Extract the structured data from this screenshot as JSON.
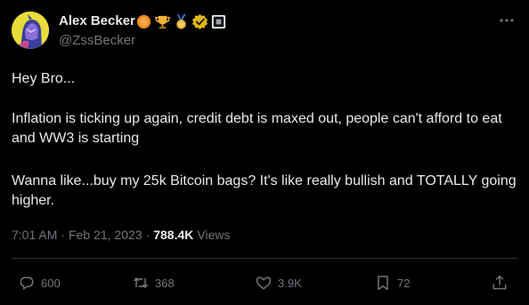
{
  "author": {
    "name": "Alex Becker",
    "handle": "@ZssBecker",
    "badges": [
      "orange-circle-icon",
      "trophy-icon",
      "medal-icon",
      "verified-badge-icon",
      "square-badge-icon"
    ]
  },
  "tweet": {
    "paragraphs": [
      "Hey Bro...",
      "Inflation is ticking up again, credit debt is maxed out, people can't afford to eat and WW3 is starting",
      "Wanna like...buy my 25k Bitcoin bags? It's like really bullish and TOTALLY going higher."
    ],
    "time": "7:01 AM",
    "date": "Feb 21, 2023",
    "views_count": "788.4K",
    "views_label": "Views"
  },
  "actions": {
    "replies": "600",
    "reposts": "368",
    "likes": "3.9K",
    "bookmarks": "72"
  },
  "colors": {
    "background": "#000000",
    "text": "#e7e9ea",
    "muted": "#71767b",
    "divider": "#2f3336",
    "verified_gold": "#f4c430",
    "avatar_bg": "#e8dc3a"
  }
}
